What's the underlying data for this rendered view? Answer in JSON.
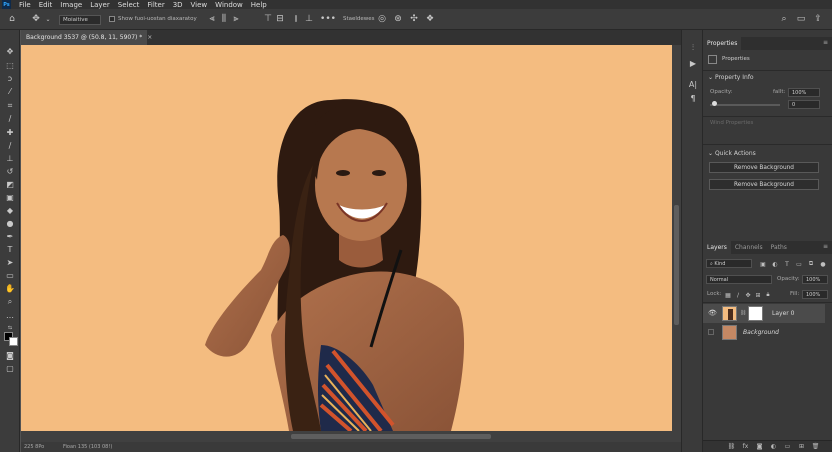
{
  "menu": {
    "logo": "Ps",
    "items": [
      "File",
      "Edit",
      "Image",
      "Layer",
      "Select",
      "Filter",
      "3D",
      "View",
      "Window",
      "Help"
    ]
  },
  "options": {
    "mode_select": "Moiaitive",
    "show_transform_label": "Show fuoi-uostan diaxaratoy",
    "stabilizer_label": "Staeldewes"
  },
  "document": {
    "tab_title": "Background 3537 @ (50.8, 11, 5907) *",
    "zoom": "225 8Po",
    "doc_info": "Fioan 135 (103 08!)"
  },
  "properties": {
    "tab_label": "Properties",
    "subtitle": "Properties",
    "property_info_header": "Property Info",
    "opacity_label": "Opacity:",
    "fill_label": "fallt:",
    "fill_value": "100%",
    "second_value": "0",
    "opacity_level": 0.06,
    "wind_properties_label": "Wind Properties",
    "quick_actions_header": "Quick Actions",
    "remove_bg_button_1": "Remove Background",
    "remove_bg_button_2": "Remove Background"
  },
  "layers_panel": {
    "tabs": [
      "Layers",
      "Channels",
      "Paths"
    ],
    "kind_filter": "Kind",
    "blend_mode": "Normal",
    "opacity_label": "Opacity:",
    "opacity_value": "100%",
    "lock_label": "Lock:",
    "fill_label": "Fill:",
    "fill_value": "100%",
    "layers": [
      {
        "name": "Layer 0",
        "visible": true
      },
      {
        "name": "Background",
        "visible": false
      }
    ]
  },
  "colors": {
    "canvas_bg": "#f4bc80",
    "panel_bg": "#393939",
    "menubar_bg": "#323232",
    "accent_ps": "#31a8ff"
  }
}
